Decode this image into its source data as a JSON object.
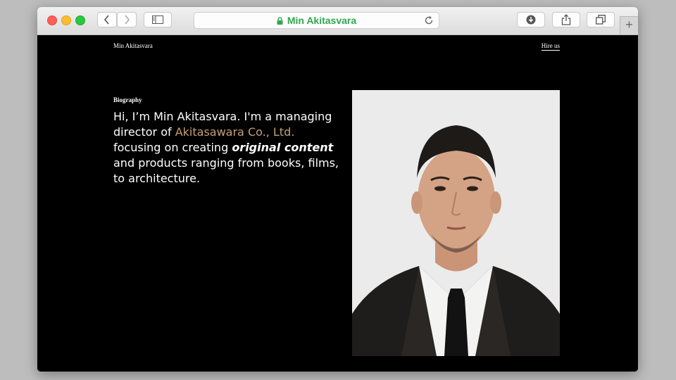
{
  "browser": {
    "address_title": "Min Akitasvara",
    "new_tab_label": "+",
    "icons": {
      "back": "chevron-left-icon",
      "forward": "chevron-right-icon",
      "sidebar": "sidebar-icon",
      "lock": "lock-icon",
      "reload": "reload-icon",
      "download": "download-icon",
      "share": "share-icon",
      "tabs": "tabs-icon"
    },
    "colors": {
      "address_title": "#2fa84f"
    }
  },
  "site": {
    "name": "Min Akitasvara",
    "hire_link": "Hire us"
  },
  "bio": {
    "label": "Biography",
    "text_1": "Hi, I’m Min Akitasvara. I'm a managing director of ",
    "company": "Akitasawara Co., Ltd.",
    "text_2": " focusing on creating ",
    "emphasis": "original content",
    "text_3": " and products ranging from books, films, to architecture.",
    "colors": {
      "accent": "#c69f79",
      "text": "#ffffff",
      "background": "#000000"
    }
  }
}
